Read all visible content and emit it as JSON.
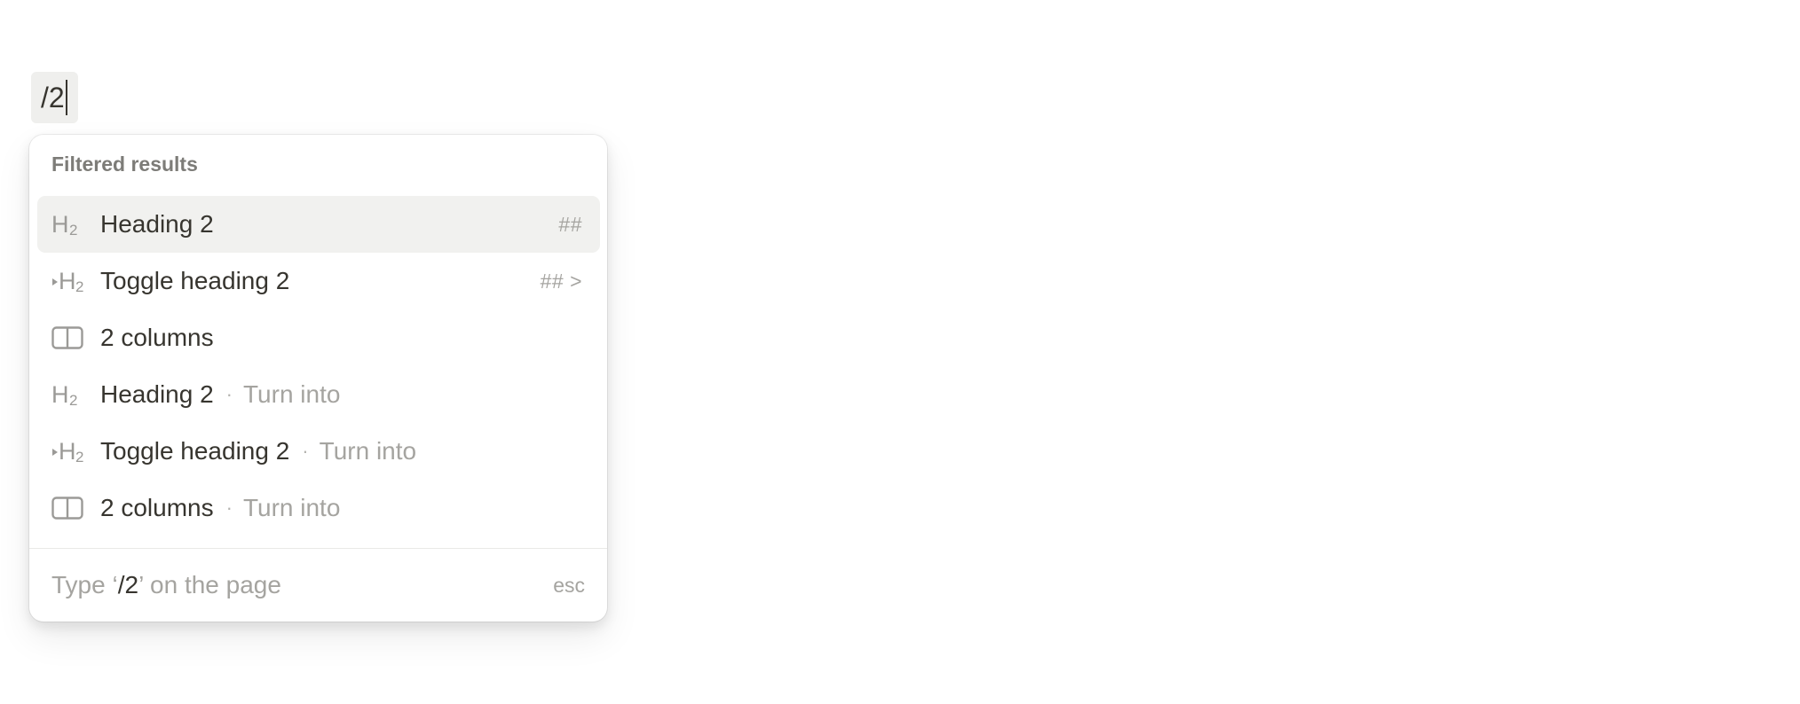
{
  "editor": {
    "slash_text": "/2"
  },
  "menu": {
    "section_title": "Filtered results",
    "items": [
      {
        "icon": "heading-2-icon",
        "label": "Heading 2",
        "shortcut": "##",
        "hint": "",
        "selected": true
      },
      {
        "icon": "toggle-heading-2-icon",
        "label": "Toggle heading 2",
        "shortcut": "## >",
        "hint": "",
        "selected": false
      },
      {
        "icon": "two-columns-icon",
        "label": "2 columns",
        "shortcut": "",
        "hint": "",
        "selected": false
      },
      {
        "icon": "heading-2-icon",
        "label": "Heading 2",
        "shortcut": "",
        "hint": "Turn into",
        "selected": false
      },
      {
        "icon": "toggle-heading-2-icon",
        "label": "Toggle heading 2",
        "shortcut": "",
        "hint": "Turn into",
        "selected": false
      },
      {
        "icon": "two-columns-icon",
        "label": "2 columns",
        "shortcut": "",
        "hint": "Turn into",
        "selected": false
      }
    ],
    "separator": "·",
    "footer": {
      "prefix": "Type ‘",
      "query": "/2",
      "suffix": "’ on the page",
      "esc_label": "esc"
    }
  },
  "colors": {
    "selected_row_bg": "#f1f1ef",
    "text_primary": "#37352f",
    "text_muted": "#a5a4a0",
    "icon_gray": "#9b9a97"
  }
}
